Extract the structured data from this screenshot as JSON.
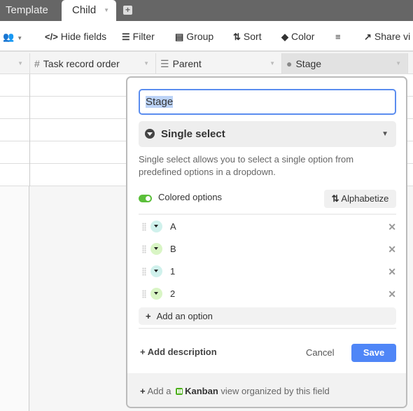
{
  "tabs": [
    {
      "label": "Template",
      "active": false
    },
    {
      "label": "Child",
      "active": true
    }
  ],
  "toolbar": {
    "hide_fields": "Hide fields",
    "filter": "Filter",
    "group": "Group",
    "sort": "Sort",
    "color": "Color",
    "share": "Share vi"
  },
  "columns": [
    {
      "label": "Task record order",
      "icon": "number-icon"
    },
    {
      "label": "Parent",
      "icon": "parent-link-icon"
    },
    {
      "label": "Stage",
      "icon": "single-select-icon"
    }
  ],
  "field_editor": {
    "name": "Stage",
    "type": "Single select",
    "description": "Single select allows you to select a single option from predefined options in a dropdown.",
    "colored_options_label": "Colored options",
    "colored_options_on": true,
    "alphabetize_label": "Alphabetize",
    "options": [
      {
        "label": "A",
        "color": "#d0f1ec"
      },
      {
        "label": "B",
        "color": "#d9f5c5"
      },
      {
        "label": "1",
        "color": "#d0f1ec"
      },
      {
        "label": "2",
        "color": "#d9f5c5"
      }
    ],
    "add_option_label": "Add an option",
    "add_description_label": "Add description",
    "cancel_label": "Cancel",
    "save_label": "Save",
    "footer": {
      "prefix": "Add a",
      "view_name": "Kanban",
      "suffix": "view organized by this field"
    }
  }
}
